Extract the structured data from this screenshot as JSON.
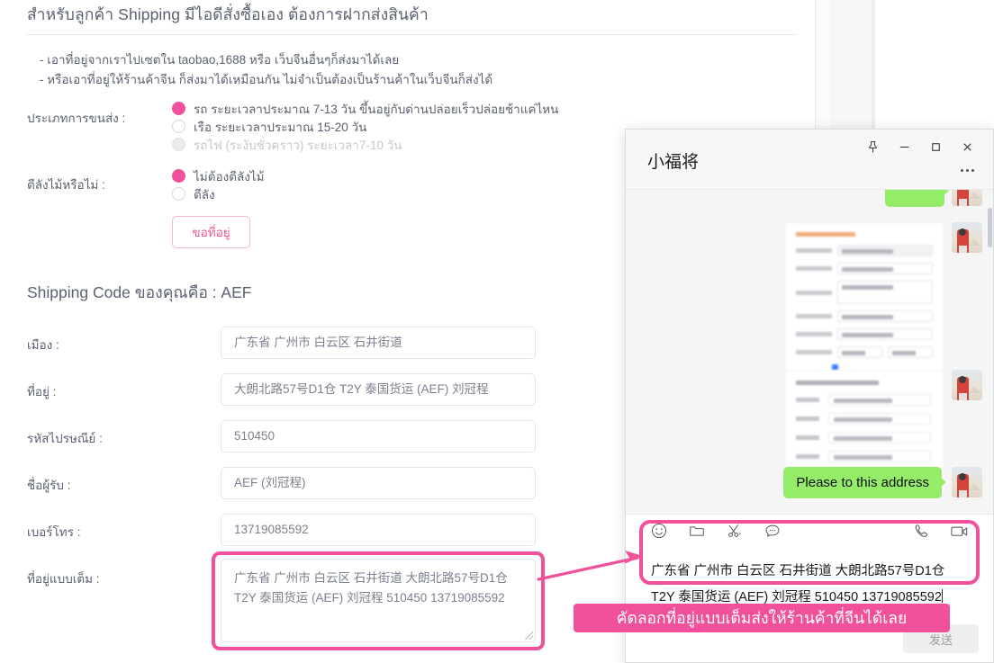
{
  "form": {
    "title": "สำหรับลูกค้า Shipping มีไอดีสั่งซื้อเอง ต้องการฝากส่งสินค้า",
    "bullets": [
      "- เอาที่อยู่จากเราไปเซตใน taobao,1688 หรือ เว็บจีนอื่นๆก็ส่งมาได้เลย",
      "- หรือเอาที่อยู่ให้ร้านค้าจีน ก็ส่งมาได้เหมือนกัน ไม่จำเป็นต้องเป็นร้านค้าในเว็บจีนก็ส่งได้"
    ],
    "shipping_type": {
      "label": "ประเภทการขนส่ง :",
      "options": [
        {
          "text": "รถ ระยะเวลาประมาณ 7-13 วัน ขึ้นอยู่กับด่านปล่อยเร็วปล่อยช้าแค่ไหน",
          "state": "checked"
        },
        {
          "text": "เรือ ระยะเวลาประมาณ 15-20 วัน",
          "state": "unchecked"
        },
        {
          "text": "รถไฟ (ระงับชั่วคราว) ระยะเวลา7-10 วัน",
          "state": "disabled"
        }
      ]
    },
    "crate": {
      "label": "ตีลังไม้หรือไม่ :",
      "options": [
        {
          "text": "ไม่ต้องตีลังไม้",
          "state": "checked"
        },
        {
          "text": "ตีลัง",
          "state": "unchecked"
        }
      ]
    },
    "request_button": "ขอที่อยู่",
    "shipping_code_title": "Shipping Code ของคุณคือ : AEF",
    "fields": [
      {
        "label": "เมือง :",
        "value": "广东省 广州市 白云区 石井街道"
      },
      {
        "label": "ที่อยู่ :",
        "value": "大朗北路57号D1仓 T2Y 泰国货运 (AEF) 刘冠程"
      },
      {
        "label": "รหัสไปรษณีย์ :",
        "value": "510450"
      },
      {
        "label": "ชื่อผู้รับ :",
        "value": "AEF (刘冠程)"
      },
      {
        "label": "เบอร์โทร :",
        "value": "13719085592"
      }
    ],
    "full_address": {
      "label": "ที่อยู่แบบเต็ม :",
      "value": "广东省 广州市 白云区 石井街道 大朗北路57号D1仓 T2Y 泰国货运 (AEF) 刘冠程 510450 13719085592"
    }
  },
  "chat": {
    "title": "小福将",
    "window_buttons": [
      "pin",
      "minimize",
      "maximize",
      "close"
    ],
    "messages": [
      {
        "type": "image",
        "kind": "address-form-screenshot"
      },
      {
        "type": "image",
        "kind": "shipping-code-screenshot"
      },
      {
        "type": "text",
        "text": "Please to this address",
        "side": "right"
      }
    ],
    "toolbar_left": [
      "emoji-icon",
      "folder-icon",
      "scissors-icon",
      "chat-bubble-icon"
    ],
    "toolbar_right": [
      "phone-icon",
      "video-icon"
    ],
    "input_value": "广东省 广州市 白云区 石井街道 大朗北路57号D1仓 T2Y 泰国货运 (AEF) 刘冠程 510450 13719085592",
    "send_label": "发送"
  },
  "annotation": {
    "banner_text": "คัดลอกที่อยู่แบบเต็มส่งให้ร้านค้าที่จีนได้เลย"
  },
  "colors": {
    "accent_pink": "#f0519a",
    "bubble_green": "#95ec69",
    "text_grey": "#5b6172"
  }
}
